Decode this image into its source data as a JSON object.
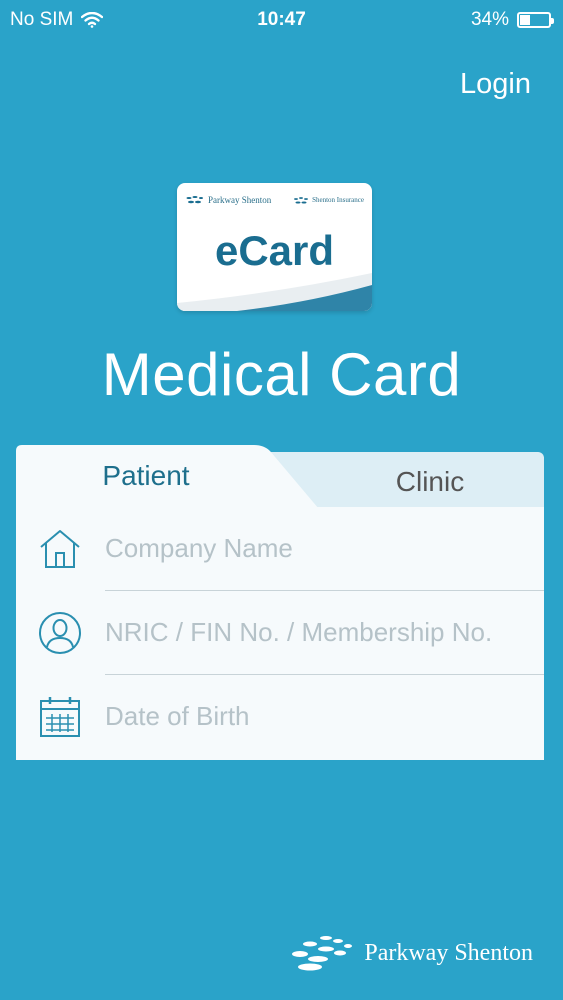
{
  "status_bar": {
    "carrier": "No SIM",
    "time": "10:47",
    "battery": "34%",
    "battery_level": 0.34
  },
  "header": {
    "login_label": "Login"
  },
  "ecard": {
    "brand_left": "Parkway Shenton",
    "brand_right": "Shenton Insurance",
    "title": "eCard"
  },
  "page_title": "Medical Card",
  "tabs": [
    {
      "label": "Patient",
      "active": true
    },
    {
      "label": "Clinic",
      "active": false
    }
  ],
  "form": {
    "company_placeholder": "Company Name",
    "nric_placeholder": "NRIC / FIN No. / Membership No.",
    "dob_placeholder": "Date of Birth"
  },
  "footer": {
    "brand": "Parkway Shenton"
  },
  "colors": {
    "background": "#2aa3c9",
    "accent": "#1e6f8c",
    "icon": "#2a8fb0"
  }
}
